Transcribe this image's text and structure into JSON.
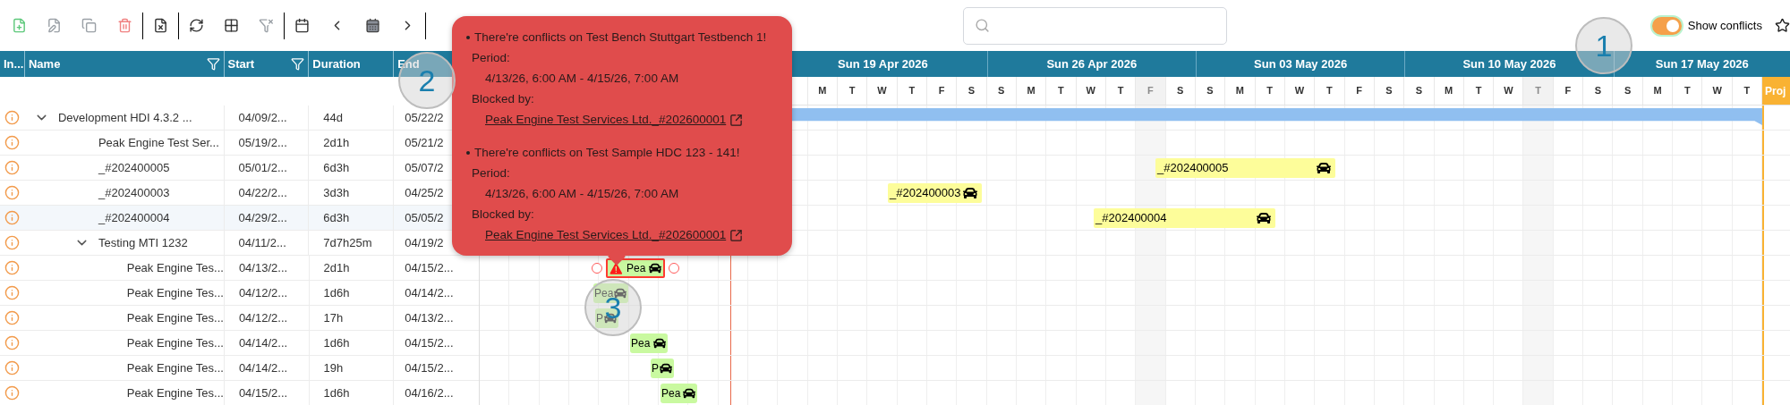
{
  "show_conflicts": {
    "label": "Show conflicts",
    "on": true
  },
  "table": {
    "columns": [
      {
        "label": "In..."
      },
      {
        "label": "Name",
        "filter": true
      },
      {
        "label": "Start",
        "filter": true
      },
      {
        "label": "Duration"
      },
      {
        "label": "End"
      }
    ],
    "rows": [
      {
        "name": "Development HDI 4.3.2 ...",
        "start": "04/09/2...",
        "duration": "44d",
        "end": "05/22/2",
        "selected": false,
        "expanded": true,
        "bar": {
          "kind": "summary"
        },
        "children": [
          {
            "name": "Peak Engine Test Ser...",
            "start": "05/19/2...",
            "duration": "2d1h",
            "end": "05/21/2",
            "selected": false
          },
          {
            "name": "_#202400005",
            "start": "05/01/2...",
            "duration": "6d3h",
            "end": "05/07/2",
            "selected": false,
            "bar": {
              "kind": "booking",
              "label": "_#202400005"
            }
          },
          {
            "name": "_#202400003",
            "start": "04/22/2...",
            "duration": "3d3h",
            "end": "04/25/2",
            "selected": false,
            "bar": {
              "kind": "booking",
              "label": "_#202400003"
            }
          },
          {
            "name": "_#202400004",
            "start": "04/29/2...",
            "duration": "6d3h",
            "end": "05/05/2",
            "selected": true,
            "bar": {
              "kind": "booking",
              "label": "_#202400004"
            }
          },
          {
            "name": "Testing MTI 1232",
            "start": "04/11/2...",
            "duration": "7d7h25m",
            "end": "04/19/2",
            "selected": false,
            "expanded": true,
            "children": [
              {
                "name": "Peak Engine Tes...",
                "start": "04/13/2...",
                "duration": "2d1h",
                "end": "04/15/2...",
                "selected": false,
                "bar": {
                  "kind": "conflict",
                  "label": "Pea"
                }
              },
              {
                "name": "Peak Engine Tes...",
                "start": "04/12/2...",
                "duration": "1d6h",
                "end": "04/14/2...",
                "selected": false,
                "bar": {
                  "kind": "task",
                  "label": "Pea"
                }
              },
              {
                "name": "Peak Engine Tes...",
                "start": "04/12/2...",
                "duration": "17h",
                "end": "04/13/2...",
                "selected": false,
                "bar": {
                  "kind": "task",
                  "label": "P"
                }
              },
              {
                "name": "Peak Engine Tes...",
                "start": "04/14/2...",
                "duration": "1d6h",
                "end": "04/15/2...",
                "selected": false,
                "bar": {
                  "kind": "task",
                  "label": "Pea"
                }
              },
              {
                "name": "Peak Engine Tes...",
                "start": "04/14/2...",
                "duration": "19h",
                "end": "04/15/2...",
                "selected": false,
                "bar": {
                  "kind": "task",
                  "label": "P"
                }
              },
              {
                "name": "Peak Engine Tes...",
                "start": "04/15/2...",
                "duration": "1d6h",
                "end": "04/16/2...",
                "selected": false,
                "bar": {
                  "kind": "task",
                  "label": "Pea"
                }
              }
            ]
          }
        ]
      }
    ]
  },
  "timeline": {
    "weeks": [
      "Sun 19 Apr 2026",
      "Sun 26 Apr 2026",
      "Sun 03 May 2026",
      "Sun 10 May 2026",
      "Sun 17 May 2026"
    ],
    "days": [
      {
        "letter": "M",
        "holiday": false
      },
      {
        "letter": "T",
        "holiday": false
      },
      {
        "letter": "W",
        "holiday": false
      },
      {
        "letter": "T",
        "holiday": false
      },
      {
        "letter": "F",
        "holiday": false
      },
      {
        "letter": "S",
        "holiday": false
      },
      {
        "letter": "S",
        "holiday": false
      },
      {
        "letter": "M",
        "holiday": false
      },
      {
        "letter": "T",
        "holiday": false
      },
      {
        "letter": "W",
        "holiday": false
      },
      {
        "letter": "T",
        "holiday": false
      },
      {
        "letter": "F",
        "holiday": true
      },
      {
        "letter": "S",
        "holiday": false
      },
      {
        "letter": "S",
        "holiday": false
      },
      {
        "letter": "M",
        "holiday": false
      },
      {
        "letter": "T",
        "holiday": false
      },
      {
        "letter": "W",
        "holiday": false
      },
      {
        "letter": "T",
        "holiday": false
      },
      {
        "letter": "F",
        "holiday": false
      },
      {
        "letter": "S",
        "holiday": false
      },
      {
        "letter": "S",
        "holiday": false
      },
      {
        "letter": "M",
        "holiday": false
      },
      {
        "letter": "T",
        "holiday": false
      },
      {
        "letter": "W",
        "holiday": false
      },
      {
        "letter": "T",
        "holiday": true
      },
      {
        "letter": "F",
        "holiday": false
      },
      {
        "letter": "S",
        "holiday": false
      },
      {
        "letter": "S",
        "holiday": false
      },
      {
        "letter": "M",
        "holiday": false
      },
      {
        "letter": "T",
        "holiday": false
      },
      {
        "letter": "W",
        "holiday": false
      },
      {
        "letter": "T",
        "holiday": false
      }
    ],
    "marker": "Proj"
  },
  "tooltip": {
    "conflicts": [
      {
        "title": "There're conflicts on Test Bench Stuttgart Testbench 1!",
        "period_label": "Period:",
        "period": "4/13/26, 6:00 AM - 4/15/26, 7:00 AM",
        "blocked_label": "Blocked by:",
        "link": "Peak Engine Test Services Ltd._#202600001"
      },
      {
        "title": "There're conflicts on Test Sample HDC 123 - 141!",
        "period_label": "Period:",
        "period": "4/13/26, 6:00 AM - 4/15/26, 7:00 AM",
        "blocked_label": "Blocked by:",
        "link": "Peak Engine Test Services Ltd._#202600001"
      }
    ]
  },
  "callouts": [
    "1",
    "2",
    "3"
  ]
}
